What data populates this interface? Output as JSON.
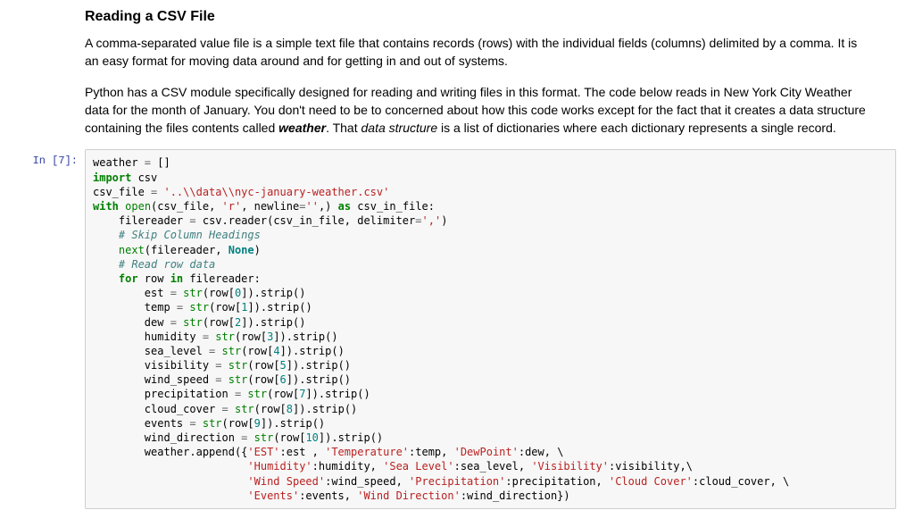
{
  "heading": "Reading a CSV File",
  "para1": "A comma-separated value file is a simple text file that contains records (rows) with the individual fields (columns) delimited by a comma. It is an easy format for moving data around and for getting in and out of systems.",
  "para2a": "Python has a CSV module specifically designed for reading and writing files in this format. The code below reads in New York City Weather data for the month of January. You don't need to be to concerned about how this code works except for the fact that it creates a data structure containing the files contents called ",
  "para2b_bold": "weather",
  "para2c": ". That ",
  "para2d_italic": "data structure",
  "para2e": " is a list of dictionaries where each dictionary represents a single record.",
  "prompt": "In [7]:",
  "code": {
    "t": {
      "weather": "weather",
      "eq": " = ",
      "empty_list": "[]",
      "import": "import",
      "csv": " csv",
      "csv_file": "csv_file",
      "csv_path": "'..\\\\data\\\\nyc-january-weather.csv'",
      "with": "with",
      "open": "open",
      "lp": "(",
      "rp": ")",
      "comma": ", ",
      "r_str": "'r'",
      "newline_kw": "newline",
      "empty_str": "''",
      "comma2": ",) ",
      "as": "as",
      "csv_in_file": " csv_in_file:",
      "filereader": "    filereader",
      "csv_reader": "csv.reader(csv_in_file, delimiter",
      "delim_str": "','",
      "cmt_skip": "    # Skip Column Headings",
      "next": "    next",
      "filereader2": "(filereader, ",
      "none": "None",
      "cmt_read": "    # Read row data",
      "for": "    for",
      "row": " row ",
      "in": "in",
      "filereader3": " filereader:",
      "est_l": "        est",
      "str_fn": "str",
      "row_l": "(row[",
      "row_r": "]).strip()",
      "n0": "0",
      "n1": "1",
      "n2": "2",
      "n3": "3",
      "n4": "4",
      "n5": "5",
      "n6": "6",
      "n7": "7",
      "n8": "8",
      "n9": "9",
      "n10": "10",
      "temp_l": "        temp",
      "dew_l": "        dew",
      "humidity_l": "        humidity",
      "sea_l": "        sea_level",
      "vis_l": "        visibility",
      "wind_l": "        wind_speed",
      "precip_l": "        precipitation",
      "cloud_l": "        cloud_cover",
      "events_l": "        events",
      "winddir_l": "        wind_direction",
      "append_l": "        weather.append({",
      "k_est": "'EST'",
      "v_est": ":est , ",
      "k_temp": "'Temperature'",
      "v_temp": ":temp, ",
      "k_dew": "'DewPoint'",
      "v_dew": ":dew, \\",
      "line2_pad": "                        ",
      "k_hum": "'Humidity'",
      "v_hum": ":humidity, ",
      "k_sea": "'Sea Level'",
      "v_sea": ":sea_level, ",
      "k_vis": "'Visibility'",
      "v_vis": ":visibility,\\",
      "k_ws": "'Wind Speed'",
      "v_ws": ":wind_speed, ",
      "k_pr": "'Precipitation'",
      "v_pr": ":precipitation, ",
      "k_cc": "'Cloud Cover'",
      "v_cc": ":cloud_cover, \\",
      "k_ev": "'Events'",
      "v_ev": ":events, ",
      "k_wd": "'Wind Direction'",
      "v_wd": ":wind_direction})"
    }
  }
}
